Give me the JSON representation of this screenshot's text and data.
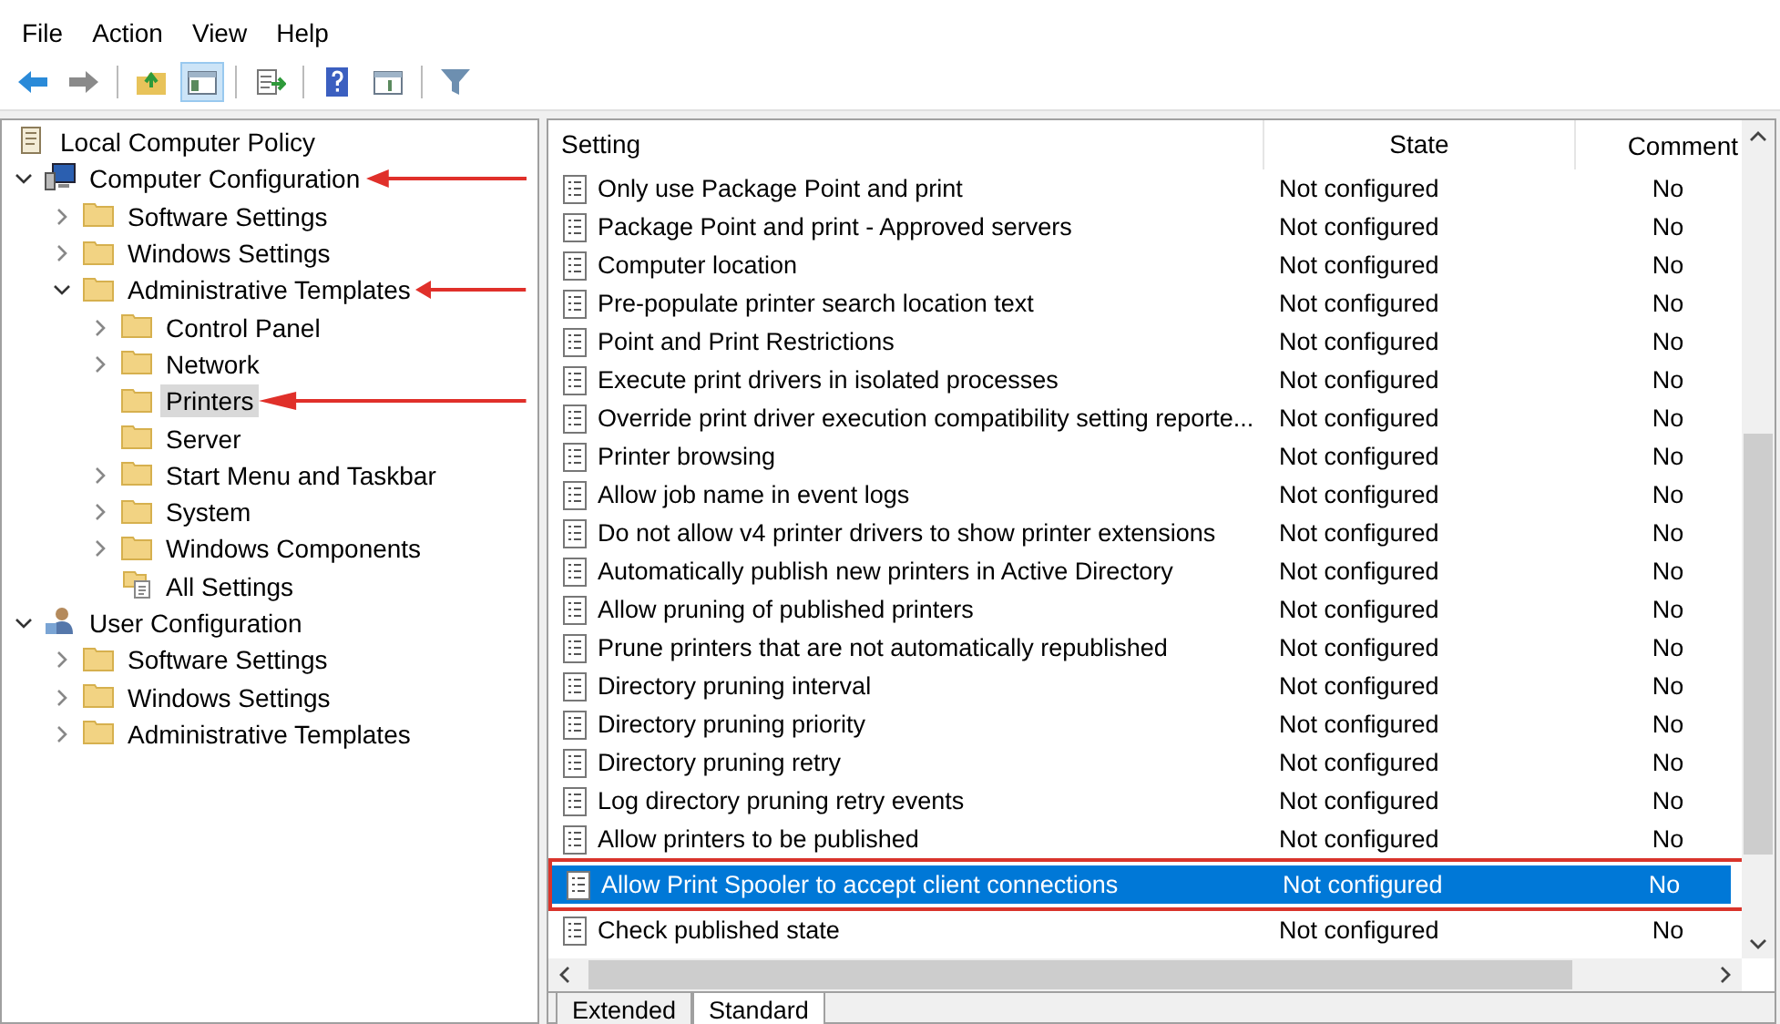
{
  "menu": [
    "File",
    "Action",
    "View",
    "Help"
  ],
  "toolbar": [
    {
      "kind": "back"
    },
    {
      "kind": "forward"
    },
    {
      "kind": "up"
    },
    {
      "kind": "tree-toggle",
      "selected": true
    },
    {
      "kind": "export"
    },
    {
      "kind": "help"
    },
    {
      "kind": "pane-toggle"
    },
    {
      "kind": "filter"
    }
  ],
  "tree": [
    {
      "label": "Local Computer Policy",
      "kind": "policy",
      "selected": false,
      "arrow": false
    },
    {
      "label": "Computer Configuration",
      "kind": "computer",
      "expanded": true,
      "selected": false,
      "arrow": true,
      "children": [
        {
          "label": "Software Settings",
          "kind": "folder",
          "expanded": false,
          "selected": false,
          "arrow": false
        },
        {
          "label": "Windows Settings",
          "kind": "folder",
          "expanded": false,
          "selected": false,
          "arrow": false
        },
        {
          "label": "Administrative Templates",
          "kind": "folder",
          "expanded": true,
          "selected": false,
          "arrow": true,
          "children": [
            {
              "label": "Control Panel",
              "kind": "folder",
              "expanded": false,
              "selected": false,
              "arrow": false
            },
            {
              "label": "Network",
              "kind": "folder",
              "expanded": false,
              "selected": false,
              "arrow": false
            },
            {
              "label": "Printers",
              "kind": "folder",
              "selected": true,
              "arrow": true
            },
            {
              "label": "Server",
              "kind": "folder",
              "selected": false,
              "arrow": false
            },
            {
              "label": "Start Menu and Taskbar",
              "kind": "folder",
              "expanded": false,
              "selected": false,
              "arrow": false
            },
            {
              "label": "System",
              "kind": "folder",
              "expanded": false,
              "selected": false,
              "arrow": false
            },
            {
              "label": "Windows Components",
              "kind": "folder",
              "expanded": false,
              "selected": false,
              "arrow": false
            },
            {
              "label": "All Settings",
              "kind": "all-settings",
              "selected": false,
              "arrow": false
            }
          ]
        }
      ]
    },
    {
      "label": "User Configuration",
      "kind": "user",
      "expanded": true,
      "selected": false,
      "arrow": false,
      "children": [
        {
          "label": "Software Settings",
          "kind": "folder",
          "expanded": false,
          "selected": false,
          "arrow": false
        },
        {
          "label": "Windows Settings",
          "kind": "folder",
          "expanded": false,
          "selected": false,
          "arrow": false
        },
        {
          "label": "Administrative Templates",
          "kind": "folder",
          "expanded": false,
          "selected": false,
          "arrow": false
        }
      ]
    }
  ],
  "table": {
    "columns": [
      "Setting",
      "State",
      "Comment"
    ],
    "rows": [
      {
        "setting": "Only use Package Point and print",
        "state": "Not configured",
        "comment": "No",
        "selected": false,
        "boxed": false
      },
      {
        "setting": "Package Point and print - Approved servers",
        "state": "Not configured",
        "comment": "No",
        "selected": false,
        "boxed": false
      },
      {
        "setting": "Computer location",
        "state": "Not configured",
        "comment": "No",
        "selected": false,
        "boxed": false
      },
      {
        "setting": "Pre-populate printer search location text",
        "state": "Not configured",
        "comment": "No",
        "selected": false,
        "boxed": false
      },
      {
        "setting": "Point and Print Restrictions",
        "state": "Not configured",
        "comment": "No",
        "selected": false,
        "boxed": false
      },
      {
        "setting": "Execute print drivers in isolated processes",
        "state": "Not configured",
        "comment": "No",
        "selected": false,
        "boxed": false
      },
      {
        "setting": "Override print driver execution compatibility setting reporte...",
        "state": "Not configured",
        "comment": "No",
        "selected": false,
        "boxed": false
      },
      {
        "setting": "Printer browsing",
        "state": "Not configured",
        "comment": "No",
        "selected": false,
        "boxed": false
      },
      {
        "setting": "Allow job name in event logs",
        "state": "Not configured",
        "comment": "No",
        "selected": false,
        "boxed": false
      },
      {
        "setting": "Do not allow v4 printer drivers to show printer extensions",
        "state": "Not configured",
        "comment": "No",
        "selected": false,
        "boxed": false
      },
      {
        "setting": "Automatically publish new printers in Active Directory",
        "state": "Not configured",
        "comment": "No",
        "selected": false,
        "boxed": false
      },
      {
        "setting": "Allow pruning of published printers",
        "state": "Not configured",
        "comment": "No",
        "selected": false,
        "boxed": false
      },
      {
        "setting": "Prune printers that are not automatically republished",
        "state": "Not configured",
        "comment": "No",
        "selected": false,
        "boxed": false
      },
      {
        "setting": "Directory pruning interval",
        "state": "Not configured",
        "comment": "No",
        "selected": false,
        "boxed": false
      },
      {
        "setting": "Directory pruning priority",
        "state": "Not configured",
        "comment": "No",
        "selected": false,
        "boxed": false
      },
      {
        "setting": "Directory pruning retry",
        "state": "Not configured",
        "comment": "No",
        "selected": false,
        "boxed": false
      },
      {
        "setting": "Log directory pruning retry events",
        "state": "Not configured",
        "comment": "No",
        "selected": false,
        "boxed": false
      },
      {
        "setting": "Allow printers to be published",
        "state": "Not configured",
        "comment": "No",
        "selected": false,
        "boxed": false
      },
      {
        "setting": "Allow Print Spooler to accept client connections",
        "state": "Not configured",
        "comment": "No",
        "selected": true,
        "boxed": true
      },
      {
        "setting": "Check published state",
        "state": "Not configured",
        "comment": "No",
        "selected": false,
        "boxed": false
      }
    ]
  },
  "tabs": [
    {
      "label": "Extended",
      "selected": false
    },
    {
      "label": "Standard",
      "selected": true
    }
  ]
}
